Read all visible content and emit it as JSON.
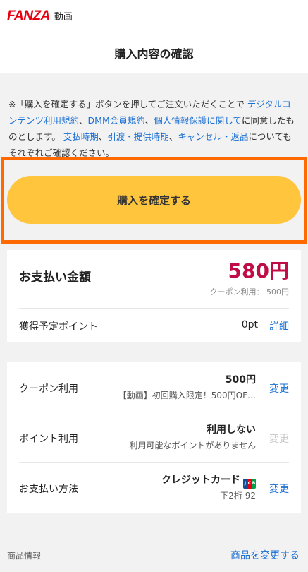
{
  "header": {
    "logo": "FANZA",
    "logo_sub": "動画"
  },
  "title": "購入内容の確認",
  "notice": {
    "p1": "※「購入を確定する」ボタンを押してご注文いただくことで",
    "link1": "デジタルコンテンツ利用規約",
    "sep1": "、",
    "link2": "DMM会員規約",
    "sep2": "、",
    "link3": "個人情報保護に関して",
    "p2": "に同意したものとします。",
    "link4": "支払時期",
    "sep3": "、",
    "link5": "引渡・提供時期",
    "sep4": "、",
    "link6": "キャンセル・返品",
    "p3": "についてもそれぞれご確認ください。"
  },
  "cta": {
    "label": "購入を確定する"
  },
  "payment": {
    "label": "お支払い金額",
    "amount": "580円",
    "coupon_note": "クーポン利用： 500円",
    "points_label": "獲得予定ポイント",
    "points_value": "0pt",
    "points_detail": "詳細"
  },
  "options": {
    "coupon": {
      "label": "クーポン利用",
      "main": "500円",
      "sub": "【動画】初回購入限定！500円OF…",
      "link": "変更"
    },
    "points": {
      "label": "ポイント利用",
      "main": "利用しない",
      "sub": "利用可能なポイントがありません",
      "link": "変更"
    },
    "method": {
      "label": "お支払い方法",
      "main": "クレジットカード",
      "sub": "下2桁 92",
      "link": "変更",
      "brand": "JCB"
    }
  },
  "products": {
    "label": "商品情報",
    "change": "商品を変更する"
  },
  "colors": {
    "accent": "#ffc53d",
    "highlight": "#ff6a00",
    "price": "#c00d47",
    "link": "#1a6fd4"
  }
}
